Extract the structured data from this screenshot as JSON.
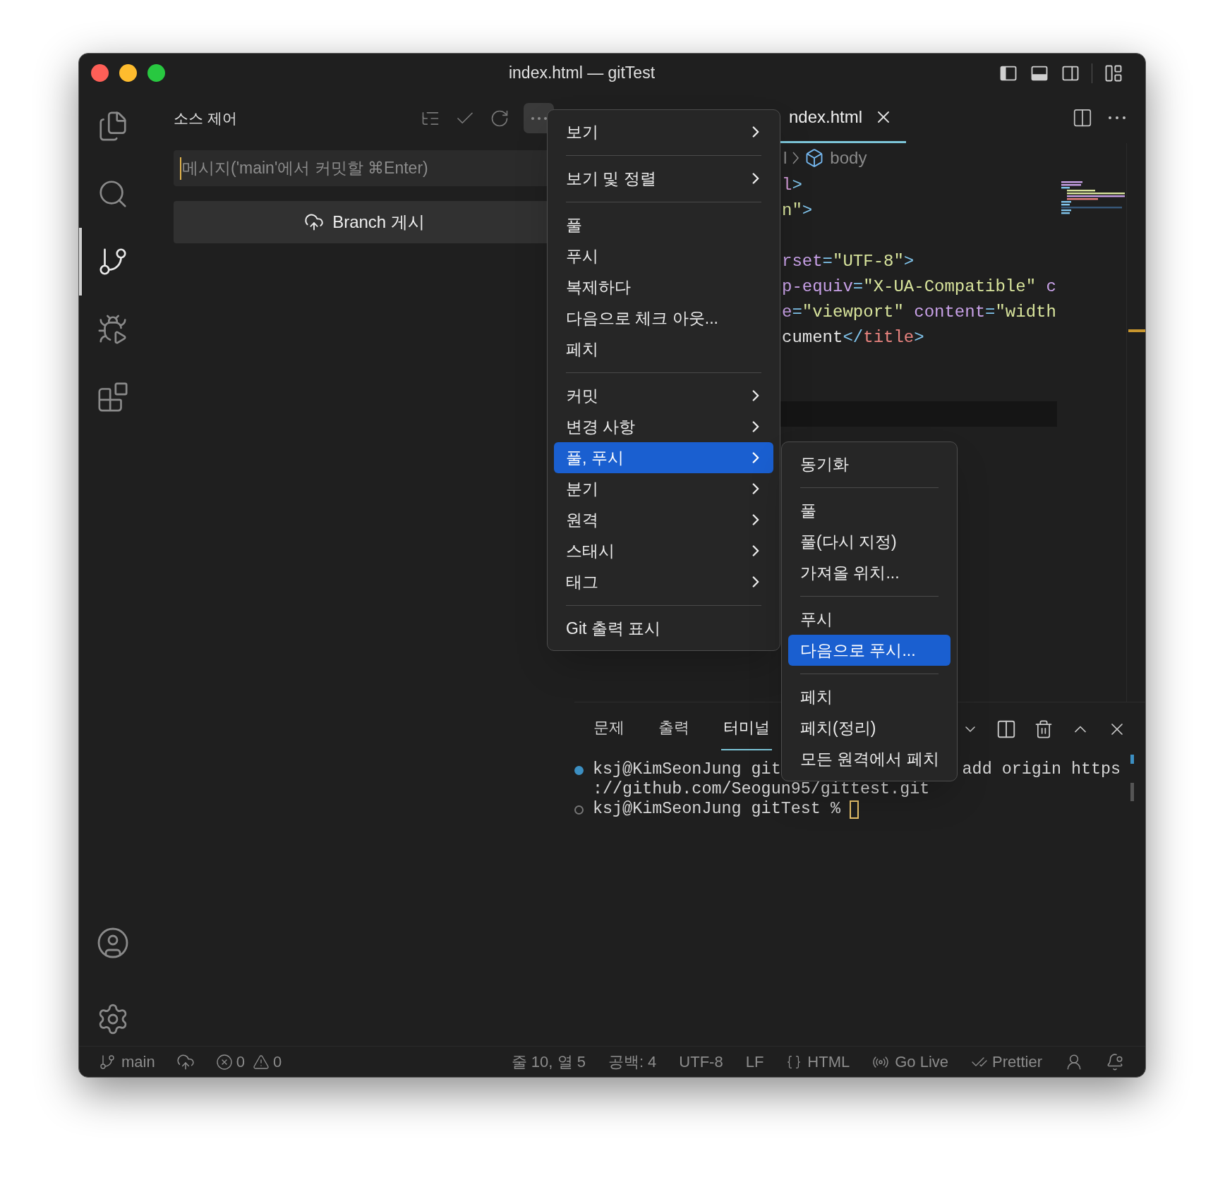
{
  "window": {
    "title": "index.html — gitTest"
  },
  "activity_bar": {
    "items": [
      {
        "kind": "files",
        "selected": false
      },
      {
        "kind": "search",
        "selected": false
      },
      {
        "kind": "source_control",
        "selected": true
      },
      {
        "kind": "run",
        "selected": false
      },
      {
        "kind": "extensions",
        "selected": false
      }
    ],
    "bottom": [
      {
        "kind": "account"
      },
      {
        "kind": "settings"
      }
    ]
  },
  "sidebar": {
    "title": "소스 제어",
    "more_active": true,
    "commit_message": {
      "placeholder": "메시지('main'에서 커밋할 ⌘Enter)"
    },
    "publish_button": "Branch 게시"
  },
  "editor": {
    "tab": {
      "label": "ndex.html"
    },
    "breadcrumb": [
      "l",
      "body"
    ],
    "lines": [
      {
        "kind": "code",
        "tokens": [
          {
            "text": "l",
            "kind": "element"
          },
          {
            "text": ">",
            "kind": "punct"
          }
        ]
      },
      {
        "kind": "code",
        "tokens": [
          {
            "text": "n\"",
            "kind": "string"
          },
          {
            "text": ">",
            "kind": "punct"
          }
        ]
      },
      {
        "kind": "blank"
      },
      {
        "kind": "code",
        "tokens": [
          {
            "text": "rset",
            "kind": "attribute"
          },
          {
            "text": "=",
            "kind": "punct"
          },
          {
            "text": "\"UTF-8\"",
            "kind": "string"
          },
          {
            "text": ">",
            "kind": "punct"
          }
        ]
      },
      {
        "kind": "code",
        "tokens": [
          {
            "text": "p-equiv",
            "kind": "attribute"
          },
          {
            "text": "=",
            "kind": "punct"
          },
          {
            "text": "\"X-UA-Compatible\"",
            "kind": "string"
          },
          {
            "text": " c",
            "kind": "attribute"
          }
        ]
      },
      {
        "kind": "code",
        "tokens": [
          {
            "text": "e",
            "kind": "attribute"
          },
          {
            "text": "=",
            "kind": "punct"
          },
          {
            "text": "\"viewport\"",
            "kind": "string"
          },
          {
            "text": " content",
            "kind": "attribute"
          },
          {
            "text": "=",
            "kind": "punct"
          },
          {
            "text": "\"width",
            "kind": "string"
          }
        ]
      },
      {
        "kind": "code",
        "tokens": [
          {
            "text": "cument",
            "kind": "text"
          },
          {
            "text": "</",
            "kind": "punct"
          },
          {
            "text": "title",
            "kind": "tag"
          },
          {
            "text": ">",
            "kind": "punct"
          }
        ]
      },
      {
        "kind": "blank"
      },
      {
        "kind": "blank"
      },
      {
        "kind": "current_blank"
      }
    ]
  },
  "panel": {
    "tabs": [
      {
        "label": "문제",
        "selected": false
      },
      {
        "label": "출력",
        "selected": false
      },
      {
        "label": "터미널",
        "selected": true
      }
    ],
    "terminal": {
      "lines": [
        {
          "kind": "success",
          "segments": [
            "ksj@KimSeonJung git",
            "add origin https"
          ],
          "cursor": false
        },
        {
          "kind": "continuation",
          "segments": [
            "://github.com/Seogun95/gittest.git"
          ],
          "cursor": false
        },
        {
          "kind": "pending",
          "segments": [
            "ksj@KimSeonJung gitTest %"
          ],
          "cursor": true
        }
      ]
    }
  },
  "context_menu": {
    "items": [
      {
        "kind": "item",
        "label": "보기",
        "submenu": true,
        "selected": false
      },
      {
        "kind": "separator"
      },
      {
        "kind": "item",
        "label": "보기 및 정렬",
        "submenu": true,
        "selected": false
      },
      {
        "kind": "separator"
      },
      {
        "kind": "item",
        "label": "풀",
        "submenu": false,
        "selected": false
      },
      {
        "kind": "item",
        "label": "푸시",
        "submenu": false,
        "selected": false
      },
      {
        "kind": "item",
        "label": "복제하다",
        "submenu": false,
        "selected": false
      },
      {
        "kind": "item",
        "label": "다음으로 체크 아웃...",
        "submenu": false,
        "selected": false
      },
      {
        "kind": "item",
        "label": "페치",
        "submenu": false,
        "selected": false
      },
      {
        "kind": "separator"
      },
      {
        "kind": "item",
        "label": "커밋",
        "submenu": true,
        "selected": false
      },
      {
        "kind": "item",
        "label": "변경 사항",
        "submenu": true,
        "selected": false
      },
      {
        "kind": "item",
        "label": "풀, 푸시",
        "submenu": true,
        "selected": true
      },
      {
        "kind": "item",
        "label": "분기",
        "submenu": true,
        "selected": false
      },
      {
        "kind": "item",
        "label": "원격",
        "submenu": true,
        "selected": false
      },
      {
        "kind": "item",
        "label": "스태시",
        "submenu": true,
        "selected": false
      },
      {
        "kind": "item",
        "label": "태그",
        "submenu": true,
        "selected": false
      },
      {
        "kind": "separator"
      },
      {
        "kind": "item",
        "label": "Git 출력 표시",
        "submenu": false,
        "selected": false
      }
    ]
  },
  "submenu": {
    "items": [
      {
        "kind": "item",
        "label": "동기화",
        "submenu": false,
        "selected": false
      },
      {
        "kind": "separator"
      },
      {
        "kind": "item",
        "label": "풀",
        "submenu": false,
        "selected": false
      },
      {
        "kind": "item",
        "label": "풀(다시 지정)",
        "submenu": false,
        "selected": false
      },
      {
        "kind": "item",
        "label": "가져올 위치...",
        "submenu": false,
        "selected": false
      },
      {
        "kind": "separator"
      },
      {
        "kind": "item",
        "label": "푸시",
        "submenu": false,
        "selected": false
      },
      {
        "kind": "item",
        "label": "다음으로 푸시...",
        "submenu": false,
        "selected": true
      },
      {
        "kind": "separator"
      },
      {
        "kind": "item",
        "label": "페치",
        "submenu": false,
        "selected": false
      },
      {
        "kind": "item",
        "label": "페치(정리)",
        "submenu": false,
        "selected": false
      },
      {
        "kind": "item",
        "label": "모든 원격에서 페치",
        "submenu": false,
        "selected": false
      }
    ]
  },
  "status_bar": {
    "branch": "main",
    "errors": "0",
    "warnings": "0",
    "position": "줄 10, 열 5",
    "indent": "공백: 4",
    "encoding": "UTF-8",
    "eol": "LF",
    "language": "HTML",
    "go_live": "Go Live",
    "prettier": "Prettier"
  }
}
